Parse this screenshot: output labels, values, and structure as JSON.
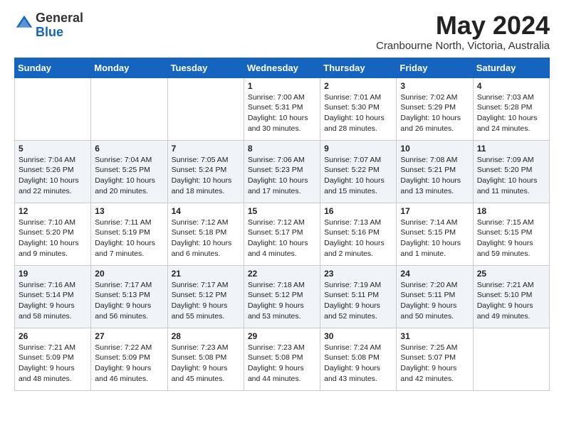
{
  "header": {
    "logo_general": "General",
    "logo_blue": "Blue",
    "month_title": "May 2024",
    "location": "Cranbourne North, Victoria, Australia"
  },
  "weekdays": [
    "Sunday",
    "Monday",
    "Tuesday",
    "Wednesday",
    "Thursday",
    "Friday",
    "Saturday"
  ],
  "weeks": [
    [
      {
        "day": "",
        "sunrise": "",
        "sunset": "",
        "daylight": ""
      },
      {
        "day": "",
        "sunrise": "",
        "sunset": "",
        "daylight": ""
      },
      {
        "day": "",
        "sunrise": "",
        "sunset": "",
        "daylight": ""
      },
      {
        "day": "1",
        "sunrise": "7:00 AM",
        "sunset": "5:31 PM",
        "daylight": "10 hours and 30 minutes."
      },
      {
        "day": "2",
        "sunrise": "7:01 AM",
        "sunset": "5:30 PM",
        "daylight": "10 hours and 28 minutes."
      },
      {
        "day": "3",
        "sunrise": "7:02 AM",
        "sunset": "5:29 PM",
        "daylight": "10 hours and 26 minutes."
      },
      {
        "day": "4",
        "sunrise": "7:03 AM",
        "sunset": "5:28 PM",
        "daylight": "10 hours and 24 minutes."
      }
    ],
    [
      {
        "day": "5",
        "sunrise": "7:04 AM",
        "sunset": "5:26 PM",
        "daylight": "10 hours and 22 minutes."
      },
      {
        "day": "6",
        "sunrise": "7:04 AM",
        "sunset": "5:25 PM",
        "daylight": "10 hours and 20 minutes."
      },
      {
        "day": "7",
        "sunrise": "7:05 AM",
        "sunset": "5:24 PM",
        "daylight": "10 hours and 18 minutes."
      },
      {
        "day": "8",
        "sunrise": "7:06 AM",
        "sunset": "5:23 PM",
        "daylight": "10 hours and 17 minutes."
      },
      {
        "day": "9",
        "sunrise": "7:07 AM",
        "sunset": "5:22 PM",
        "daylight": "10 hours and 15 minutes."
      },
      {
        "day": "10",
        "sunrise": "7:08 AM",
        "sunset": "5:21 PM",
        "daylight": "10 hours and 13 minutes."
      },
      {
        "day": "11",
        "sunrise": "7:09 AM",
        "sunset": "5:20 PM",
        "daylight": "10 hours and 11 minutes."
      }
    ],
    [
      {
        "day": "12",
        "sunrise": "7:10 AM",
        "sunset": "5:20 PM",
        "daylight": "10 hours and 9 minutes."
      },
      {
        "day": "13",
        "sunrise": "7:11 AM",
        "sunset": "5:19 PM",
        "daylight": "10 hours and 7 minutes."
      },
      {
        "day": "14",
        "sunrise": "7:12 AM",
        "sunset": "5:18 PM",
        "daylight": "10 hours and 6 minutes."
      },
      {
        "day": "15",
        "sunrise": "7:12 AM",
        "sunset": "5:17 PM",
        "daylight": "10 hours and 4 minutes."
      },
      {
        "day": "16",
        "sunrise": "7:13 AM",
        "sunset": "5:16 PM",
        "daylight": "10 hours and 2 minutes."
      },
      {
        "day": "17",
        "sunrise": "7:14 AM",
        "sunset": "5:15 PM",
        "daylight": "10 hours and 1 minute."
      },
      {
        "day": "18",
        "sunrise": "7:15 AM",
        "sunset": "5:15 PM",
        "daylight": "9 hours and 59 minutes."
      }
    ],
    [
      {
        "day": "19",
        "sunrise": "7:16 AM",
        "sunset": "5:14 PM",
        "daylight": "9 hours and 58 minutes."
      },
      {
        "day": "20",
        "sunrise": "7:17 AM",
        "sunset": "5:13 PM",
        "daylight": "9 hours and 56 minutes."
      },
      {
        "day": "21",
        "sunrise": "7:17 AM",
        "sunset": "5:12 PM",
        "daylight": "9 hours and 55 minutes."
      },
      {
        "day": "22",
        "sunrise": "7:18 AM",
        "sunset": "5:12 PM",
        "daylight": "9 hours and 53 minutes."
      },
      {
        "day": "23",
        "sunrise": "7:19 AM",
        "sunset": "5:11 PM",
        "daylight": "9 hours and 52 minutes."
      },
      {
        "day": "24",
        "sunrise": "7:20 AM",
        "sunset": "5:11 PM",
        "daylight": "9 hours and 50 minutes."
      },
      {
        "day": "25",
        "sunrise": "7:21 AM",
        "sunset": "5:10 PM",
        "daylight": "9 hours and 49 minutes."
      }
    ],
    [
      {
        "day": "26",
        "sunrise": "7:21 AM",
        "sunset": "5:09 PM",
        "daylight": "9 hours and 48 minutes."
      },
      {
        "day": "27",
        "sunrise": "7:22 AM",
        "sunset": "5:09 PM",
        "daylight": "9 hours and 46 minutes."
      },
      {
        "day": "28",
        "sunrise": "7:23 AM",
        "sunset": "5:08 PM",
        "daylight": "9 hours and 45 minutes."
      },
      {
        "day": "29",
        "sunrise": "7:23 AM",
        "sunset": "5:08 PM",
        "daylight": "9 hours and 44 minutes."
      },
      {
        "day": "30",
        "sunrise": "7:24 AM",
        "sunset": "5:08 PM",
        "daylight": "9 hours and 43 minutes."
      },
      {
        "day": "31",
        "sunrise": "7:25 AM",
        "sunset": "5:07 PM",
        "daylight": "9 hours and 42 minutes."
      },
      {
        "day": "",
        "sunrise": "",
        "sunset": "",
        "daylight": ""
      }
    ]
  ],
  "labels": {
    "sunrise": "Sunrise:",
    "sunset": "Sunset:",
    "daylight": "Daylight:"
  }
}
